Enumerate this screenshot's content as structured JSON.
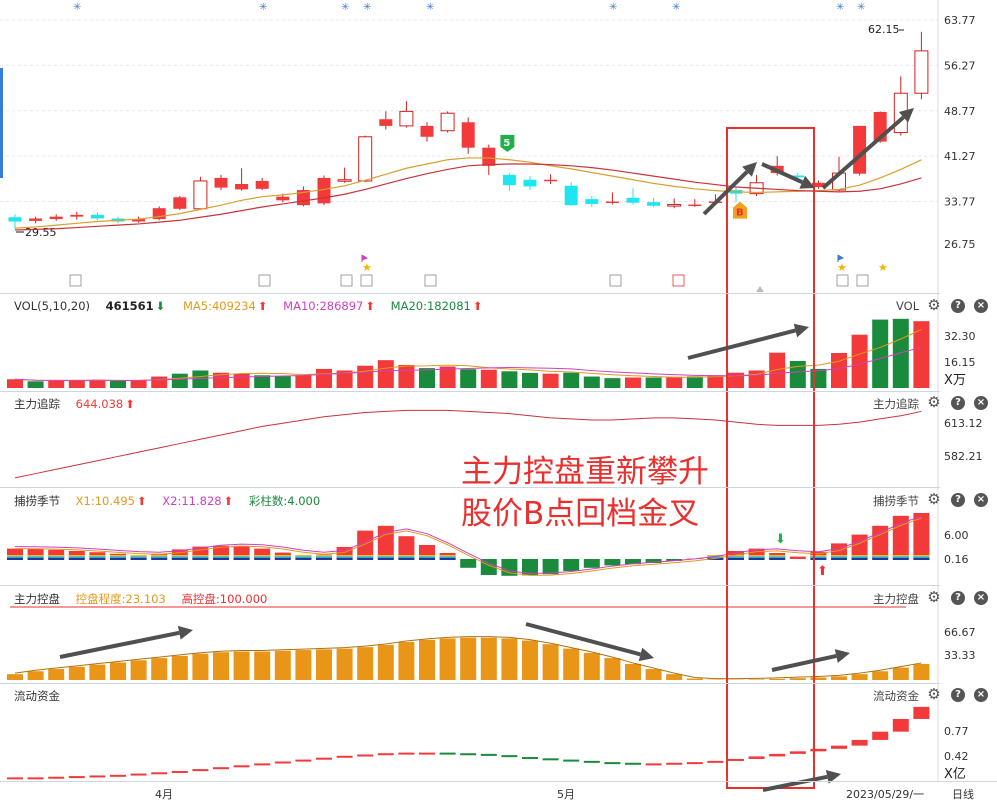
{
  "colors": {
    "up": "#f23a3a",
    "down_kline": "#1ee6f0",
    "down_bar": "#1a8a3c",
    "ma5": "#e09a1e",
    "ma10": "#d03a8a",
    "ma20": "#2e9a3c",
    "orange_bar": "#e89518",
    "annot": "#e8302f"
  },
  "main": {
    "y_ticks": [
      "63.77",
      "56.27",
      "48.77",
      "41.27",
      "33.77",
      "26.75"
    ],
    "high_label": "62.15",
    "low_label": "29.55",
    "marker_letters": [
      "5",
      "B"
    ]
  },
  "vol": {
    "title": "VOL(5,10,20)",
    "value": "461561",
    "ma5": "MA5:409234",
    "ma10": "MA10:286897",
    "ma20": "MA20:182081",
    "right_label": "VOL",
    "y_ticks": [
      "32.30",
      "16.15"
    ],
    "unit": "X万"
  },
  "track": {
    "title": "主力追踪",
    "value": "644.038",
    "right_label": "主力追踪",
    "y_ticks": [
      "613.12",
      "582.21"
    ]
  },
  "season": {
    "title": "捕捞季节",
    "x1": "X1:10.495",
    "x2": "X2:11.828",
    "count": "彩柱数:4.000",
    "right_label": "捕捞季节",
    "y_ticks": [
      "6.00",
      "0.16"
    ]
  },
  "control": {
    "title": "主力控盘",
    "degree": "控盘程度:23.103",
    "high": "高控盘:100.000",
    "right_label": "主力控盘",
    "y_ticks": [
      "66.67",
      "33.33"
    ]
  },
  "flow": {
    "title": "流动资金",
    "right_label": "流动资金",
    "y_ticks": [
      "0.77",
      "0.42"
    ],
    "unit": "X亿"
  },
  "annotation": {
    "line1": "主力控盘重新攀升",
    "line2": "股价B点回档金叉"
  },
  "footer": {
    "month1": "4月",
    "month2": "5月",
    "date": "2023/05/29/一",
    "period": "日线"
  },
  "chart_data": {
    "type": "candlestick",
    "candles": [
      {
        "o": 31.5,
        "c": 30.8,
        "h": 32.0,
        "l": 29.55
      },
      {
        "o": 30.9,
        "c": 31.3,
        "h": 31.6,
        "l": 30.5
      },
      {
        "o": 31.2,
        "c": 31.6,
        "h": 32.0,
        "l": 30.9
      },
      {
        "o": 31.6,
        "c": 31.9,
        "h": 32.4,
        "l": 31.1
      },
      {
        "o": 31.9,
        "c": 31.3,
        "h": 32.3,
        "l": 31.0
      },
      {
        "o": 31.3,
        "c": 30.8,
        "h": 31.6,
        "l": 30.5
      },
      {
        "o": 30.8,
        "c": 31.2,
        "h": 31.6,
        "l": 30.6
      },
      {
        "o": 31.2,
        "c": 33.0,
        "h": 33.3,
        "l": 31.0
      },
      {
        "o": 32.9,
        "c": 34.8,
        "h": 35.0,
        "l": 32.7
      },
      {
        "o": 32.9,
        "c": 37.5,
        "h": 38.2,
        "l": 32.8
      },
      {
        "o": 36.4,
        "c": 38.0,
        "h": 38.5,
        "l": 36.0
      },
      {
        "o": 36.1,
        "c": 37.0,
        "h": 39.6,
        "l": 35.9
      },
      {
        "o": 36.2,
        "c": 37.5,
        "h": 38.0,
        "l": 36.0
      },
      {
        "o": 34.3,
        "c": 34.9,
        "h": 35.4,
        "l": 34.0
      },
      {
        "o": 33.5,
        "c": 36.0,
        "h": 36.6,
        "l": 33.3
      },
      {
        "o": 33.8,
        "c": 38.0,
        "h": 38.4,
        "l": 33.5
      },
      {
        "o": 37.5,
        "c": 37.7,
        "h": 39.7,
        "l": 37.2
      },
      {
        "o": 37.5,
        "c": 44.8,
        "h": 45.0,
        "l": 37.3
      },
      {
        "o": 46.6,
        "c": 47.7,
        "h": 49.0,
        "l": 46.0
      },
      {
        "o": 46.6,
        "c": 49.0,
        "h": 50.7,
        "l": 46.3
      },
      {
        "o": 44.8,
        "c": 46.6,
        "h": 47.2,
        "l": 44.0
      },
      {
        "o": 45.8,
        "c": 48.7,
        "h": 49.0,
        "l": 45.5
      },
      {
        "o": 43.0,
        "c": 47.2,
        "h": 48.0,
        "l": 42.0
      },
      {
        "o": 40.0,
        "c": 43.0,
        "h": 43.5,
        "l": 38.5
      },
      {
        "o": 38.5,
        "c": 36.8,
        "h": 38.8,
        "l": 35.9
      },
      {
        "o": 37.7,
        "c": 36.6,
        "h": 38.3,
        "l": 36.0
      },
      {
        "o": 37.7,
        "c": 37.7,
        "h": 38.6,
        "l": 37.0
      },
      {
        "o": 36.7,
        "c": 33.5,
        "h": 37.3,
        "l": 33.4
      },
      {
        "o": 34.5,
        "c": 33.7,
        "h": 35.0,
        "l": 33.2
      },
      {
        "o": 34.1,
        "c": 34.1,
        "h": 35.6,
        "l": 33.6
      },
      {
        "o": 34.7,
        "c": 33.9,
        "h": 36.3,
        "l": 33.6
      },
      {
        "o": 34.0,
        "c": 33.4,
        "h": 34.7,
        "l": 33.2
      },
      {
        "o": 33.6,
        "c": 33.6,
        "h": 34.6,
        "l": 33.0
      },
      {
        "o": 33.6,
        "c": 33.6,
        "h": 34.5,
        "l": 33.2
      },
      {
        "o": 34.1,
        "c": 34.1,
        "h": 35.3,
        "l": 33.6
      },
      {
        "o": 36.0,
        "c": 35.4,
        "h": 36.5,
        "l": 34.0
      },
      {
        "o": 35.4,
        "c": 37.2,
        "h": 38.5,
        "l": 35.0
      },
      {
        "o": 38.8,
        "c": 40.0,
        "h": 41.6,
        "l": 38.4
      },
      {
        "o": 38.4,
        "c": 38.1,
        "h": 38.8,
        "l": 37.2
      },
      {
        "o": 36.5,
        "c": 37.2,
        "h": 37.6,
        "l": 36.2
      },
      {
        "o": 36.0,
        "c": 38.8,
        "h": 41.5,
        "l": 35.8
      },
      {
        "o": 38.7,
        "c": 46.6,
        "h": 46.6,
        "l": 38.4
      },
      {
        "o": 44.0,
        "c": 48.9,
        "h": 49.0,
        "l": 43.8
      },
      {
        "o": 45.5,
        "c": 52.0,
        "h": 54.8,
        "l": 45.0
      },
      {
        "o": 52.0,
        "c": 59.0,
        "h": 62.15,
        "l": 51.0
      }
    ],
    "ma_yellow": [
      29.7,
      29.9,
      30.2,
      30.5,
      30.8,
      31.0,
      31.2,
      31.6,
      32.1,
      32.8,
      33.5,
      34.3,
      34.9,
      35.2,
      35.6,
      36.1,
      36.7,
      37.6,
      38.6,
      39.6,
      40.3,
      41.0,
      41.3,
      41.3,
      41.0,
      40.6,
      40.0,
      39.5,
      38.9,
      38.3,
      37.7,
      37.1,
      36.6,
      36.2,
      35.9,
      35.7,
      35.6,
      35.7,
      35.8,
      35.9,
      36.1,
      36.8,
      38.0,
      39.4,
      41.0
    ],
    "ma_red": [
      29.4,
      29.5,
      29.6,
      29.8,
      30.0,
      30.2,
      30.4,
      30.7,
      31.0,
      31.5,
      32.0,
      32.6,
      33.2,
      33.7,
      34.2,
      34.7,
      35.3,
      36.1,
      37.0,
      37.9,
      38.7,
      39.4,
      40.0,
      40.2,
      40.3,
      40.3,
      40.2,
      40.0,
      39.7,
      39.3,
      38.8,
      38.3,
      37.8,
      37.3,
      36.9,
      36.5,
      36.3,
      36.1,
      35.9,
      35.8,
      35.7,
      35.8,
      36.2,
      37.0,
      38.0
    ],
    "volume": [
      5.5,
      4.2,
      4.6,
      5.0,
      5.2,
      4.4,
      4.7,
      7.2,
      9.0,
      11.0,
      9.6,
      8.8,
      8.0,
      7.6,
      8.0,
      12.0,
      11.0,
      14.0,
      17.5,
      14.5,
      12.5,
      13.5,
      11.8,
      11.5,
      10.5,
      9.5,
      9.0,
      9.6,
      7.2,
      6.2,
      6.6,
      6.6,
      7.0,
      7.3,
      8.0,
      9.6,
      11.0,
      22.2,
      17.0,
      12.0,
      22.0,
      33.5,
      43.0,
      43.5,
      42.0
    ],
    "volume_up": [
      true,
      false,
      true,
      true,
      true,
      false,
      true,
      true,
      false,
      false,
      true,
      true,
      false,
      false,
      true,
      true,
      true,
      true,
      true,
      true,
      false,
      true,
      false,
      true,
      false,
      false,
      true,
      false,
      false,
      false,
      true,
      false,
      true,
      false,
      true,
      true,
      true,
      true,
      false,
      false,
      true,
      true,
      false,
      false,
      true
    ],
    "track_line": [
      562,
      566,
      570,
      574,
      578,
      582,
      586,
      590,
      594,
      598,
      602,
      606,
      610,
      613,
      616,
      619,
      621,
      623,
      624,
      625,
      625,
      625,
      624,
      623,
      622,
      620,
      618,
      617,
      616,
      616,
      617,
      618,
      618,
      617,
      616,
      614,
      612,
      611,
      611,
      611,
      612,
      614,
      617,
      620,
      624
    ],
    "season_bars": [
      2.6,
      2.5,
      2.3,
      2.0,
      1.7,
      1.3,
      1.0,
      1.3,
      2.4,
      3.1,
      3.3,
      3.3,
      2.6,
      1.6,
      0.9,
      1.1,
      3.0,
      7.1,
      8.3,
      5.7,
      3.5,
      1.5,
      -2.2,
      -4.0,
      -4.2,
      -4.1,
      -3.8,
      -3.0,
      -2.2,
      -1.6,
      -1.3,
      -1.0,
      -0.5,
      0.1,
      0.9,
      2.0,
      2.6,
      1.5,
      0.6,
      1.8,
      3.9,
      6.1,
      8.3,
      10.8,
      11.5
    ],
    "control_bars": [
      8,
      12,
      15,
      18,
      21,
      24,
      27,
      30,
      33,
      36,
      38,
      39,
      39,
      40,
      41,
      42,
      43,
      45,
      48,
      52,
      55,
      57,
      58,
      58,
      57,
      54,
      49,
      43,
      37,
      30,
      22,
      15,
      8,
      2,
      0.5,
      0.5,
      0.8,
      1.5,
      2.5,
      3.5,
      5,
      8,
      12,
      17,
      22
    ],
    "flow_vals": [
      -0.14,
      -0.14,
      -0.13,
      -0.12,
      -0.11,
      -0.1,
      -0.08,
      -0.06,
      -0.04,
      -0.01,
      0.02,
      0.05,
      0.08,
      0.11,
      0.14,
      0.17,
      0.2,
      0.22,
      0.24,
      0.25,
      0.25,
      0.24,
      0.23,
      0.21,
      0.18,
      0.16,
      0.14,
      0.12,
      0.1,
      0.09,
      0.08,
      0.08,
      0.09,
      0.1,
      0.12,
      0.15,
      0.19,
      0.23,
      0.27,
      0.31,
      0.36,
      0.45,
      0.58,
      0.78,
      0.97
    ]
  }
}
